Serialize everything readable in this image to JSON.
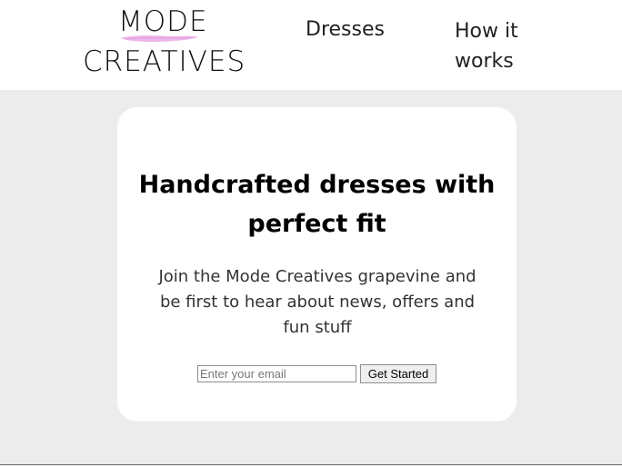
{
  "logo": {
    "line1": "MODE",
    "line2": "CREATIVES",
    "brush_color": "#e8a3e2"
  },
  "nav": {
    "dresses_label": "Dresses",
    "how_it_works_label": "How it works"
  },
  "hero": {
    "headline": "Handcrafted dresses with perfect fit",
    "subtext": "Join the Mode Creatives grapevine and be first to hear about news, offers and fun stuff",
    "email_placeholder": "Enter your email",
    "email_value": "",
    "cta_label": "Get Started"
  },
  "colors": {
    "page_background": "#ececec",
    "header_background": "#ffffff",
    "card_background": "#ffffff"
  }
}
